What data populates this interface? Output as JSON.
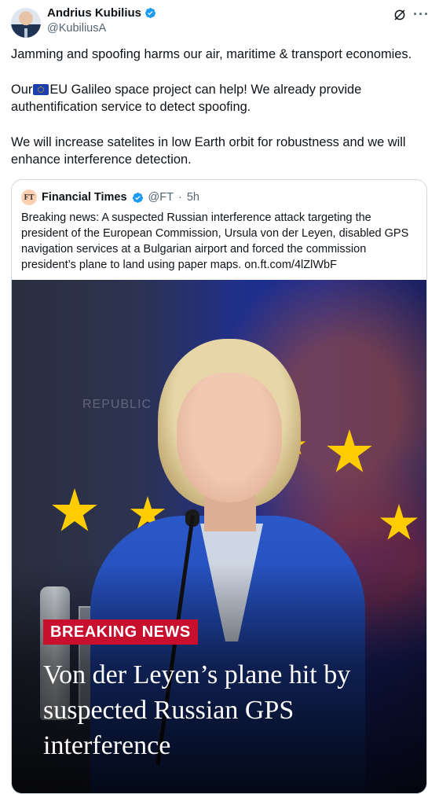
{
  "tweet": {
    "author_name": "Andrius Kubilius",
    "author_handle": "@KubiliusA",
    "paragraphs": {
      "p1": "Jamming and spoofing harms our air, maritime & transport economies.",
      "p2_before_flag": "Our",
      "p2_after_flag": "EU Galileo space project can help! We already provide authentification service to detect spoofing.",
      "p3": "We will increase satelites in low Earth orbit for robustness and we will enhance interference detection."
    },
    "icons": {
      "verified": "verified-badge-icon",
      "grok": "grok-icon",
      "more": "more-icon",
      "flag": "eu-flag-emoji"
    }
  },
  "quoted": {
    "logo_text": "FT",
    "name": "Financial Times",
    "handle": "@FT",
    "separator": "·",
    "time": "5h",
    "text": "Breaking news: A suspected Russian interference attack targeting the president of the European Commission, Ursula von der Leyen, disabled GPS navigation services at a Bulgarian airport and forced the commission president’s plane to land using paper maps.",
    "link": "on.ft.com/4lZlWbF",
    "image": {
      "badge": "BREAKING NEWS",
      "headline": "Von der Leyen’s plane hit by suspected Russian GPS interference",
      "background_sign": "REPUBLIC"
    }
  },
  "colors": {
    "verified": "#1d9bf0",
    "badge": "#c8102e",
    "ft_logo_bg": "#fcd0b1",
    "text": "#0f1419",
    "muted": "#536471"
  }
}
